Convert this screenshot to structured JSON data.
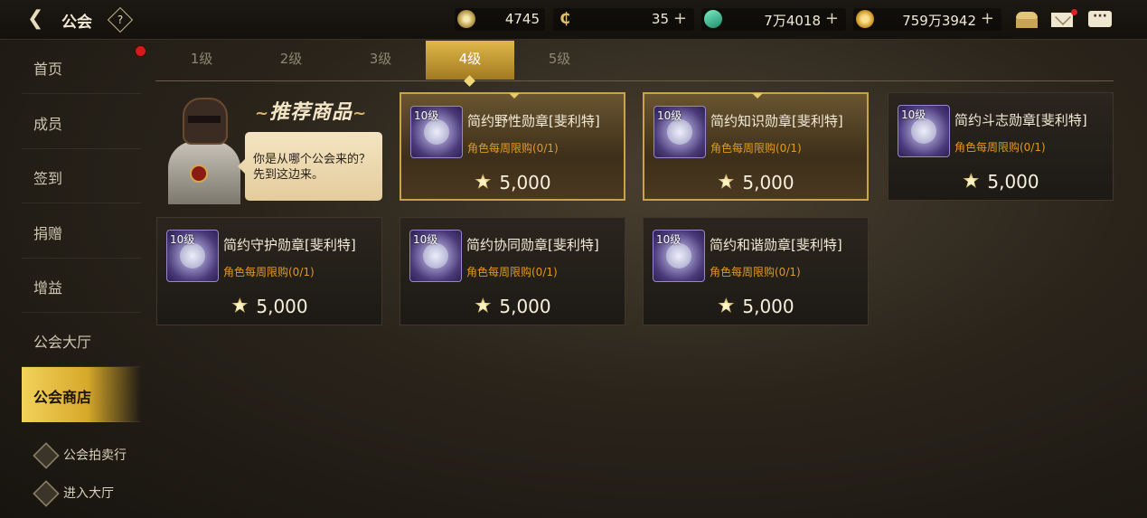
{
  "header": {
    "title": "公会",
    "help_label": "?",
    "resources": [
      {
        "icon": "star-coin-icon",
        "value": "4745",
        "plus": ""
      },
      {
        "icon": "c-coin-icon",
        "value": "35",
        "plus": "+"
      },
      {
        "icon": "gem-icon",
        "value": "7万4018",
        "plus": "+"
      },
      {
        "icon": "gold-coin-icon",
        "value": "759万3942",
        "plus": "+"
      }
    ]
  },
  "sidebar": {
    "items": [
      {
        "label": "首页"
      },
      {
        "label": "成员"
      },
      {
        "label": "签到"
      },
      {
        "label": "捐赠"
      },
      {
        "label": "增益"
      },
      {
        "label": "公会大厅"
      },
      {
        "label": "公会商店"
      }
    ],
    "active_index": 6,
    "links": [
      {
        "label": "公会拍卖行"
      },
      {
        "label": "进入大厅"
      }
    ]
  },
  "tabs": [
    {
      "label": "1级"
    },
    {
      "label": "2级"
    },
    {
      "label": "3级"
    },
    {
      "label": "4级"
    },
    {
      "label": "5级"
    }
  ],
  "active_tab": 3,
  "promo": {
    "title": "推荐商品",
    "speech": "你是从哪个公会来的？先到这边来。"
  },
  "items": [
    {
      "level": "10级",
      "name": "简约野性勋章[斐利特]",
      "limit": "角色每周限购(0/1)",
      "price": "5,000",
      "highlight": true
    },
    {
      "level": "10级",
      "name": "简约知识勋章[斐利特]",
      "limit": "角色每周限购(0/1)",
      "price": "5,000",
      "highlight": true
    },
    {
      "level": "10级",
      "name": "简约斗志勋章[斐利特]",
      "limit": "角色每周限购(0/1)",
      "price": "5,000",
      "highlight": false
    },
    {
      "level": "10级",
      "name": "简约守护勋章[斐利特]",
      "limit": "角色每周限购(0/1)",
      "price": "5,000",
      "highlight": false
    },
    {
      "level": "10级",
      "name": "简约协同勋章[斐利特]",
      "limit": "角色每周限购(0/1)",
      "price": "5,000",
      "highlight": false
    },
    {
      "level": "10级",
      "name": "简约和谐勋章[斐利特]",
      "limit": "角色每周限购(0/1)",
      "price": "5,000",
      "highlight": false
    }
  ]
}
